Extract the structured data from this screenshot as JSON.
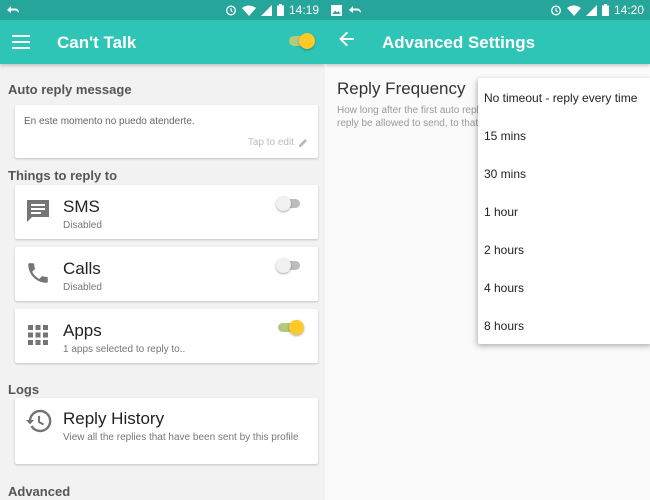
{
  "left": {
    "statusbar": {
      "time": "14:19"
    },
    "appbar": {
      "title": "Can't Talk",
      "master_enabled": true
    },
    "auto_reply": {
      "section": "Auto reply message",
      "message": "En este momento no puedo atenderte.",
      "tap_to_edit": "Tap to edit"
    },
    "things": {
      "section": "Things to reply to",
      "items": [
        {
          "title": "SMS",
          "subtitle": "Disabled",
          "enabled": false,
          "icon": "message-icon"
        },
        {
          "title": "Calls",
          "subtitle": "Disabled",
          "enabled": false,
          "icon": "phone-icon"
        },
        {
          "title": "Apps",
          "subtitle": "1 apps selected to reply to..",
          "enabled": true,
          "icon": "apps-grid-icon"
        }
      ]
    },
    "logs": {
      "section": "Logs",
      "history_title": "Reply History",
      "history_sub": "View all the replies that have been sent by this profile"
    },
    "advanced": {
      "section": "Advanced"
    }
  },
  "right": {
    "statusbar": {
      "time": "14:20"
    },
    "appbar": {
      "title": "Advanced Settings"
    },
    "reply_frequency": {
      "title": "Reply Frequency",
      "description": "How long after the first auto reply message, should another auto reply be allowed to send, to that same"
    },
    "menu": {
      "options": [
        "No timeout - reply every time",
        "15 mins",
        "30 mins",
        "1 hour",
        "2 hours",
        "4 hours",
        "8 hours"
      ]
    }
  },
  "colors": {
    "primary": "#2ec4b6",
    "primary_dark": "#26a69a",
    "accent": "#ffca28",
    "icon_grey": "#757575"
  }
}
